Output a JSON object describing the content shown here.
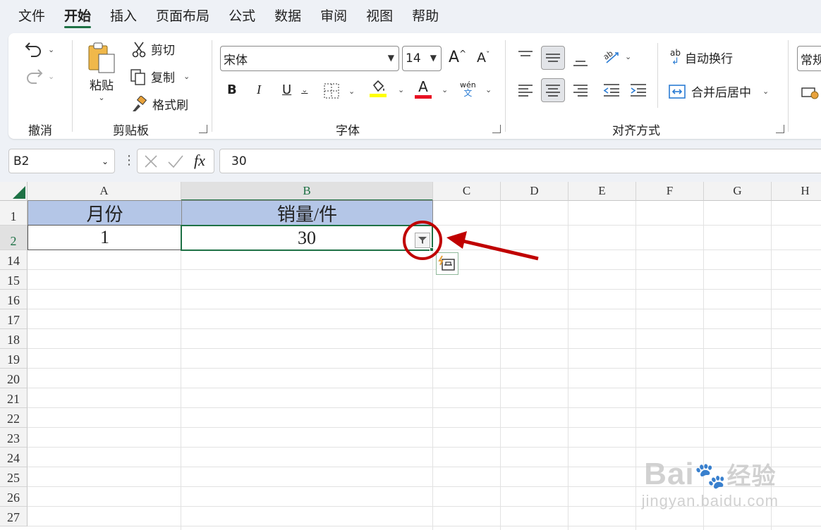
{
  "menu": {
    "items": [
      {
        "label": "文件"
      },
      {
        "label": "开始"
      },
      {
        "label": "插入"
      },
      {
        "label": "页面布局"
      },
      {
        "label": "公式"
      },
      {
        "label": "数据"
      },
      {
        "label": "审阅"
      },
      {
        "label": "视图"
      },
      {
        "label": "帮助"
      }
    ],
    "active_index": 1
  },
  "ribbon": {
    "undo_group_label": "撤消",
    "clipboard": {
      "paste_label": "粘贴",
      "cut_label": "剪切",
      "copy_label": "复制",
      "format_painter_label": "格式刷",
      "group_label": "剪贴板"
    },
    "font": {
      "font_name": "宋体",
      "font_size": "14",
      "bold_label": "B",
      "italic_label": "I",
      "underline_label": "U",
      "font_color_label": "A",
      "phonetic_top": "wén",
      "phonetic_bottom": "文",
      "grow_label": "A",
      "shrink_label": "A",
      "group_label": "字体",
      "highlight_color": "#ffff00",
      "font_color": "#e81123"
    },
    "alignment": {
      "wrap_text_label": "自动换行",
      "merge_center_label": "合并后居中",
      "group_label": "对齐方式",
      "wrap_icon_text": "ab"
    },
    "number": {
      "format_value": "常规"
    }
  },
  "formula_bar": {
    "name_box": "B2",
    "fx_label": "fx",
    "content": "30"
  },
  "sheet": {
    "columns": [
      "A",
      "B",
      "C",
      "D",
      "E",
      "F",
      "G",
      "H"
    ],
    "selected_column": "B",
    "rows": [
      "1",
      "2",
      "14",
      "15",
      "16",
      "17",
      "18",
      "19",
      "20",
      "21",
      "22",
      "23",
      "24",
      "25",
      "26",
      "27"
    ],
    "selected_row": "2",
    "table": {
      "headers": [
        "月份",
        "销量/件"
      ],
      "row": [
        "1",
        "30"
      ]
    },
    "header_fill": "#b4c6e7",
    "accent": "#1e7145"
  },
  "annotation": {
    "color": "#c00000"
  },
  "watermark": {
    "brand": "Bai",
    "brand_cn": "经验",
    "url": "jingyan.baidu.com"
  }
}
